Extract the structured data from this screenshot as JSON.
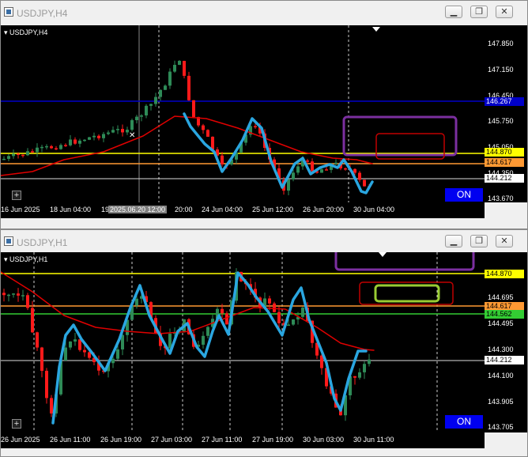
{
  "h4": {
    "title": "USDJPY,H4",
    "symbol": "USDJPY,H4",
    "on_label": "ON",
    "plus_label": "+",
    "price_labels": [
      "147.850",
      "147.150",
      "146.450",
      "145.750",
      "145.050",
      "144.350",
      "143.670"
    ],
    "price_tags": [
      {
        "text": "146.267",
        "bg": "#0000c8",
        "fg": "#ffffff"
      },
      {
        "text": "144.870",
        "bg": "#ffff00",
        "fg": "#000000"
      },
      {
        "text": "144.617",
        "bg": "#ff9933",
        "fg": "#000000"
      },
      {
        "text": "144.212",
        "bg": "#ffffff",
        "fg": "#000000"
      }
    ],
    "time_labels": [
      "16 Jun 2025",
      "18 Jun 04:00",
      "19",
      "2025.06.20 12:00",
      "20:00",
      "24 Jun 04:00",
      "25 Jun 12:00",
      "26 Jun 20:00",
      "30 Jun 04:00"
    ]
  },
  "h1": {
    "title": "USDJPY,H1",
    "symbol": "USDJPY,H1",
    "on_label": "ON",
    "plus_label": "+",
    "price_labels": [
      "144.695",
      "144.495",
      "144.300",
      "144.100",
      "143.905",
      "143.705"
    ],
    "price_tags": [
      {
        "text": "144.870",
        "bg": "#ffff00",
        "fg": "#000000"
      },
      {
        "text": "144.617",
        "bg": "#ff9933",
        "fg": "#000000"
      },
      {
        "text": "144.562",
        "bg": "#33cc33",
        "fg": "#000000"
      },
      {
        "text": "144.212",
        "bg": "#ffffff",
        "fg": "#000000"
      }
    ],
    "time_labels": [
      "26 Jun 2025",
      "26 Jun 11:00",
      "26 Jun 19:00",
      "27 Jun 03:00",
      "27 Jun 11:00",
      "27 Jun 19:00",
      "30 Jun 03:00",
      "30 Jun 11:00"
    ]
  },
  "colors": {
    "bull": "#2e8b57",
    "bear": "#ff1a1a",
    "ma": "#e00000",
    "zigzag": "#2aa6e0",
    "blue_line": "#0000c8",
    "yellow_line": "#ffff00",
    "orange_line": "#ff9933",
    "green_line": "#33cc33",
    "purple_box": "#7b2fa0",
    "red_box": "#c00000",
    "green_box": "#99cc33"
  },
  "window_buttons": {
    "minimize": "▁",
    "restore": "❐",
    "close": "✕"
  }
}
